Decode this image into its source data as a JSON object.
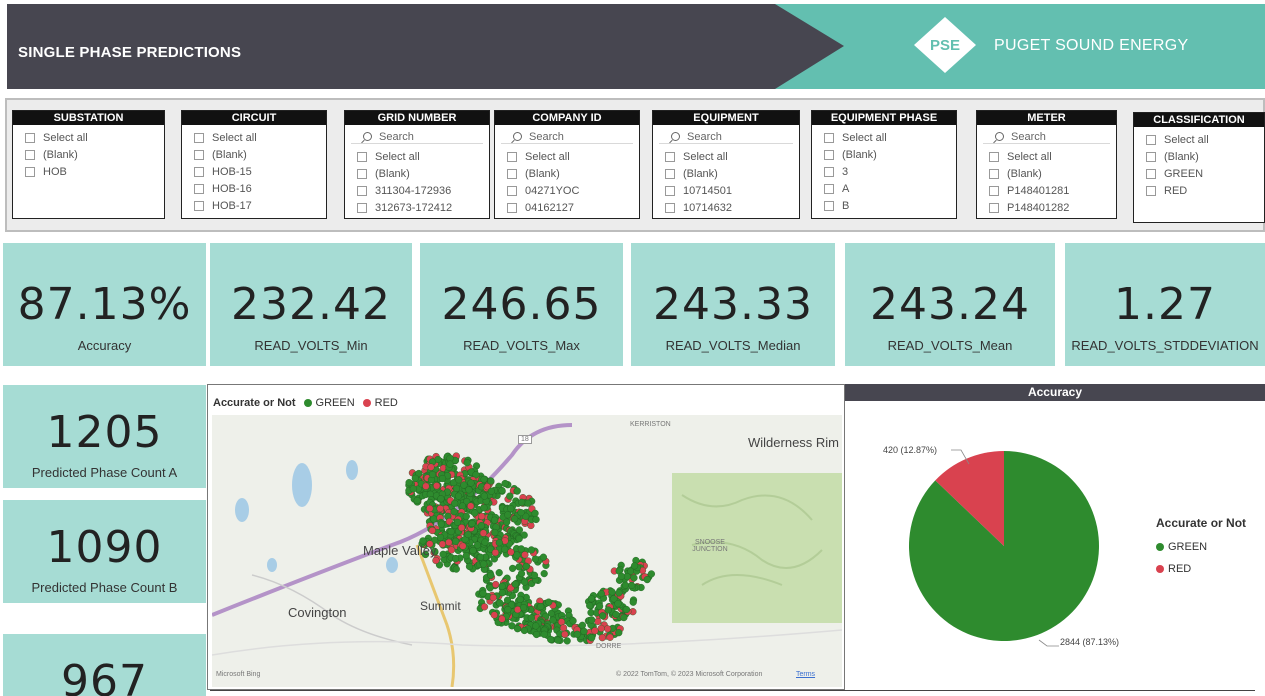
{
  "header": {
    "title": "SINGLE PHASE PREDICTIONS",
    "logo_text": "PSE",
    "company": "PUGET SOUND ENERGY",
    "colors": {
      "dark": "#474650",
      "teal": "#63bfb0"
    }
  },
  "slicers": [
    {
      "title": "SUBSTATION",
      "search": null,
      "options": [
        "Select all",
        "(Blank)",
        "HOB"
      ]
    },
    {
      "title": "CIRCUIT",
      "search": null,
      "options": [
        "Select all",
        "(Blank)",
        "HOB-15",
        "HOB-16",
        "HOB-17"
      ]
    },
    {
      "title": "GRID NUMBER",
      "search": "Search",
      "options": [
        "Select all",
        "(Blank)",
        "311304-172936",
        "312673-172412"
      ]
    },
    {
      "title": "COMPANY ID",
      "search": "Search",
      "options": [
        "Select all",
        "(Blank)",
        "04271YOC",
        "04162127"
      ]
    },
    {
      "title": "EQUIPMENT",
      "search": "Search",
      "options": [
        "Select all",
        "(Blank)",
        "10714501",
        "10714632"
      ]
    },
    {
      "title": "EQUIPMENT PHASE",
      "search": null,
      "options": [
        "Select all",
        "(Blank)",
        "3",
        "A",
        "B"
      ]
    },
    {
      "title": "METER",
      "search": "Search",
      "options": [
        "Select all",
        "(Blank)",
        "P148401281",
        "P148401282"
      ]
    },
    {
      "title": "CLASSIFICATION",
      "search": null,
      "options": [
        "Select all",
        "(Blank)",
        "GREEN",
        "RED"
      ]
    }
  ],
  "kpis": [
    {
      "value": "87.13%",
      "label": "Accuracy"
    },
    {
      "value": "232.42",
      "label": "READ_VOLTS_Min"
    },
    {
      "value": "246.65",
      "label": "READ_VOLTS_Max"
    },
    {
      "value": "243.33",
      "label": "READ_VOLTS_Median"
    },
    {
      "value": "243.24",
      "label": "READ_VOLTS_Mean"
    },
    {
      "value": "1.27",
      "label": "READ_VOLTS_STDDEVIATION"
    }
  ],
  "phase_counts": [
    {
      "value": "1205",
      "label": "Predicted Phase Count A"
    },
    {
      "value": "1090",
      "label": "Predicted Phase Count B"
    },
    {
      "value": "967",
      "label": ""
    }
  ],
  "map": {
    "legend_title": "Accurate or Not",
    "legend": [
      {
        "label": "GREEN",
        "color": "#2e8b2e"
      },
      {
        "label": "RED",
        "color": "#d9424f"
      }
    ],
    "places": [
      "Wilderness Rim",
      "Maple Valley",
      "Covington",
      "Summit",
      "KERRISTON",
      "SNOOSE JUNCTION",
      "DORRE"
    ],
    "copyright": "© 2022 TomTom, © 2023 Microsoft Corporation",
    "terms": "Terms",
    "brand": "Microsoft Bing",
    "highway": "18"
  },
  "chart_data": {
    "type": "pie",
    "title": "Accuracy",
    "legend_title": "Accurate or Not",
    "legend_position": "right",
    "slices": [
      {
        "label": "GREEN",
        "value": 2844,
        "percent": 87.13,
        "color": "#2e8b2e",
        "data_label": "2844 (87.13%)"
      },
      {
        "label": "RED",
        "value": 420,
        "percent": 12.87,
        "color": "#d9424f",
        "data_label": "420 (12.87%)"
      }
    ]
  }
}
